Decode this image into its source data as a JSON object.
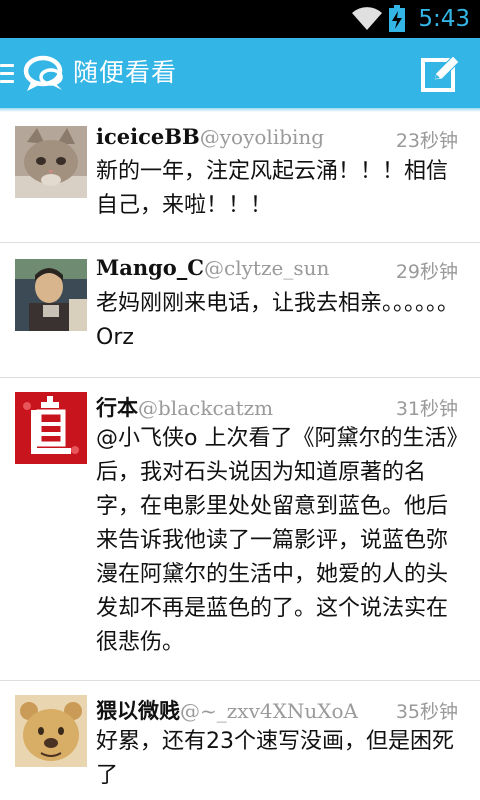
{
  "status_bar": {
    "time": "5:43"
  },
  "action_bar": {
    "title": "随便看看"
  },
  "tweets": [
    {
      "name": "iceiceBB",
      "handle": "@yoyolibing",
      "time": "23秒钟",
      "text": "新的一年，注定风起云涌！！！相信自己，来啦！！！"
    },
    {
      "name": "Mango_C",
      "handle": "@clytze_sun",
      "time": "29秒钟",
      "text": "老妈刚刚来电话，让我去相亲。。。。。。Orz"
    },
    {
      "name": "行本",
      "handle": "@blackcatzm",
      "time": "31秒钟",
      "text": "@小飞侠o 上次看了《阿黛尔的生活》后，我对石头说因为知道原著的名字，在电影里处处留意到蓝色。他后来告诉我他读了一篇影评，说蓝色弥漫在阿黛尔的生活中，她爱的人的头发却不再是蓝色的了。这个说法实在很悲伤。"
    },
    {
      "name": "猥以微贱",
      "handle": "@~_zxv4XNuXoA",
      "time": "35秒钟",
      "text": "好累，还有23个速写没画，但是困死了"
    }
  ]
}
